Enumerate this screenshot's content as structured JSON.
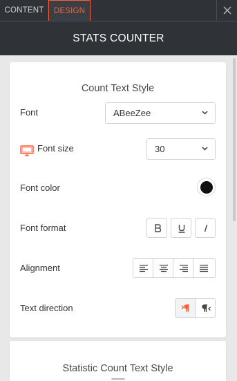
{
  "tabs": [
    {
      "label": "CONTENT",
      "active": false
    },
    {
      "label": "DESIGN",
      "active": true
    }
  ],
  "panel_title": "STATS COUNTER",
  "count_text_style": {
    "title": "Count Text Style",
    "font": {
      "label": "Font",
      "value": "ABeeZee"
    },
    "font_size": {
      "label": "Font size",
      "value": "30",
      "device_icon": "desktop-monitor-icon"
    },
    "font_color": {
      "label": "Font color",
      "value": "#111111"
    },
    "font_format": {
      "label": "Font format",
      "buttons": [
        "bold",
        "underline",
        "italic"
      ]
    },
    "alignment": {
      "label": "Alignment",
      "options": [
        "align-left",
        "align-center",
        "align-right",
        "justify"
      ]
    },
    "text_direction": {
      "label": "Text direction",
      "options": [
        "left-to-right",
        "right-to-left"
      ],
      "selected": "left-to-right"
    }
  },
  "statistic_count_text_style": {
    "title": "Statistic Count Text Style"
  },
  "colors": {
    "accent": "#ff5e3a",
    "header_bg": "#2f3338",
    "page_bg": "#e8e8e8"
  }
}
